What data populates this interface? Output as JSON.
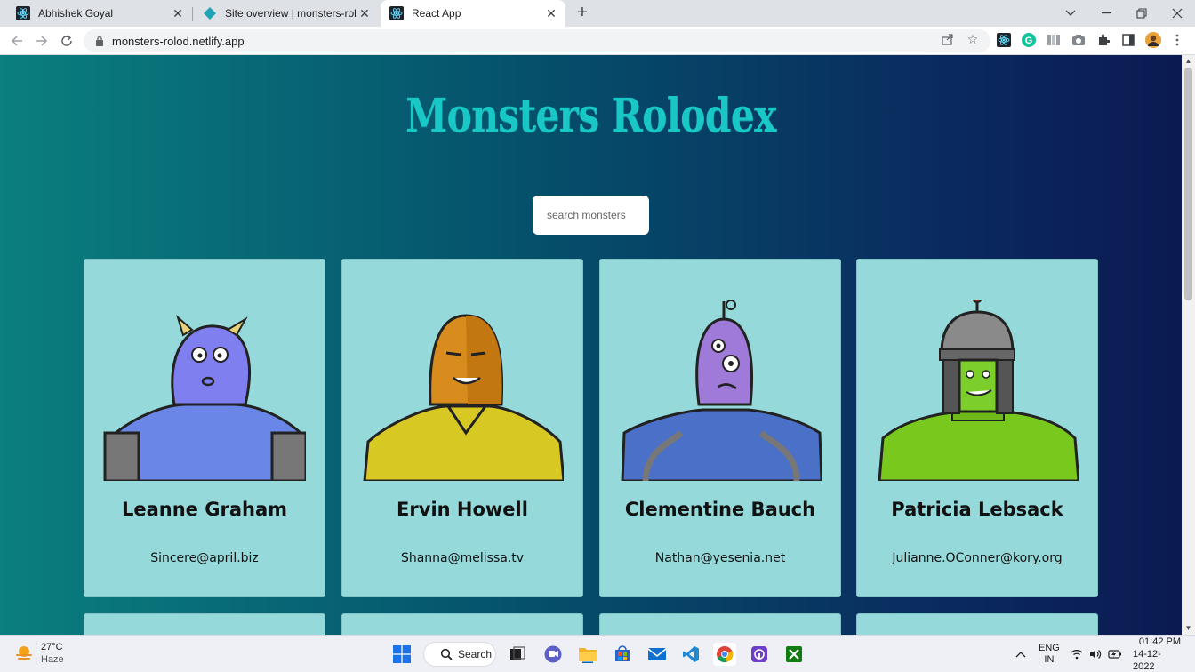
{
  "browser": {
    "tabs": [
      {
        "title": "Abhishek Goyal",
        "icon": "react-icon",
        "active": false
      },
      {
        "title": "Site overview | monsters-rolod",
        "icon": "netlify-icon",
        "active": false
      },
      {
        "title": "React App",
        "icon": "react-icon",
        "active": true
      }
    ],
    "url": "monsters-rolod.netlify.app"
  },
  "page": {
    "title": "Monsters Rolodex",
    "search_placeholder": "search monsters",
    "monsters": [
      {
        "name": "Leanne Graham",
        "email": "Sincere@april.biz",
        "skin": "#7f7ff0",
        "body": "#6a86e6",
        "accent": "#e8d27a"
      },
      {
        "name": "Ervin Howell",
        "email": "Shanna@melissa.tv",
        "skin": "#d98c1e",
        "body": "#d8c824",
        "accent": "#7a6a10"
      },
      {
        "name": "Clementine Bauch",
        "email": "Nathan@yesenia.net",
        "skin": "#a07ad8",
        "body": "#4a70c8",
        "accent": "#9a9a9a"
      },
      {
        "name": "Patricia Lebsack",
        "email": "Julianne.OConner@kory.org",
        "skin": "#7ccf2a",
        "body": "#78c81e",
        "accent": "#8a8a8a"
      }
    ]
  },
  "taskbar": {
    "temperature": "27°C",
    "weather": "Haze",
    "search_label": "Search",
    "lang": "ENG",
    "region": "IN",
    "time": "01:42 PM",
    "date": "14-12-2022"
  }
}
